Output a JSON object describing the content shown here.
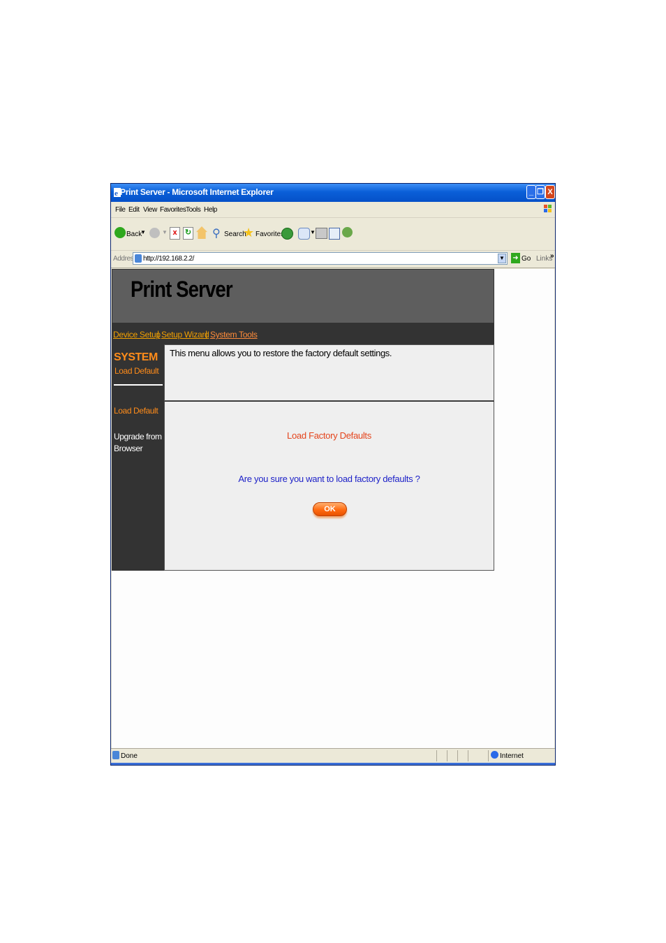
{
  "window": {
    "title": "Print Server - Microsoft Internet Explorer",
    "minimize": "_",
    "restore": "❐",
    "close": "X"
  },
  "menu": [
    "File",
    "Edit",
    "View",
    "Favorites",
    "Tools",
    "Help"
  ],
  "toolbar": {
    "back_label": "Back",
    "search_label": "Search",
    "favorites_label": "Favorites"
  },
  "address": {
    "label": "Address",
    "url": "http://192.168.2.2/",
    "go_label": "Go",
    "links_label": "Links"
  },
  "page": {
    "header_title": "Print Server",
    "nav": {
      "device_setup": "Device Setup",
      "setup_wizard": "Setup Wizard",
      "system_tools": "System Tools",
      "separator": "|"
    },
    "sidebar": {
      "section": "SYSTEM",
      "section_sub": "Load Default",
      "link_load_default": "Load Default",
      "link_upgrade": "Upgrade from Browser"
    },
    "description": "This menu allows you to restore the factory default settings.",
    "heading": "Load Factory Defaults",
    "question": "Are you sure you want to load factory defaults ?",
    "ok_label": "OK"
  },
  "status": {
    "text": "Done",
    "zone": "Internet"
  },
  "colors": {
    "titlebar": "#0a5fd8",
    "header_bg": "#5e5e5e",
    "nav_bg": "#333333",
    "accent_orange": "#ff8c1a",
    "question_blue": "#1e22c8",
    "heading_red": "#e4441c"
  }
}
